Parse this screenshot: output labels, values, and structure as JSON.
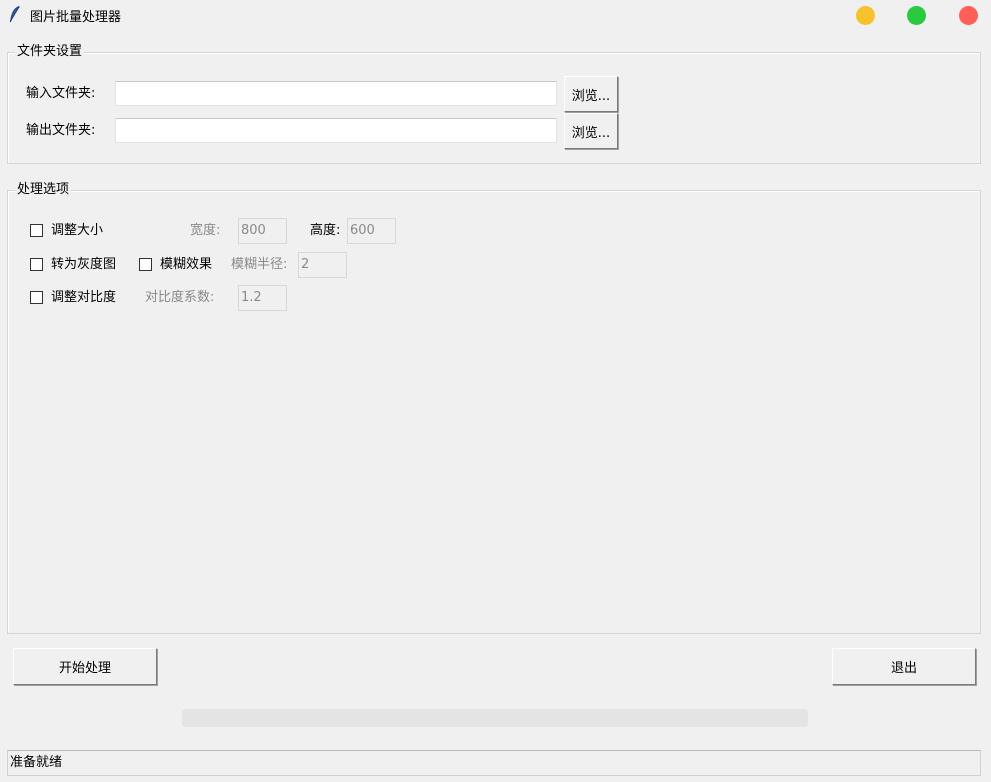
{
  "window": {
    "title": "图片批量处理器",
    "buttons": {
      "minimize_color": "#f8c22f",
      "maximize_color": "#29c940",
      "close_color": "#ff5f57"
    }
  },
  "folder_settings": {
    "legend": "文件夹设置",
    "input_label": "输入文件夹:",
    "input_value": "",
    "output_label": "输出文件夹:",
    "output_value": "",
    "browse_label": "浏览..."
  },
  "options": {
    "legend": "处理选项",
    "resize": {
      "label": "调整大小",
      "checked": false,
      "width_label": "宽度:",
      "width_value": "800",
      "height_label": "高度:",
      "height_value": "600"
    },
    "grayscale": {
      "label": "转为灰度图",
      "checked": false
    },
    "blur": {
      "label": "模糊效果",
      "checked": false,
      "radius_label": "模糊半径:",
      "radius_value": "2"
    },
    "contrast": {
      "label": "调整对比度",
      "checked": false,
      "factor_label": "对比度系数:",
      "factor_value": "1.2"
    }
  },
  "actions": {
    "start_label": "开始处理",
    "exit_label": "退出"
  },
  "progress": {
    "value": 0
  },
  "status": {
    "text": "准备就绪"
  }
}
